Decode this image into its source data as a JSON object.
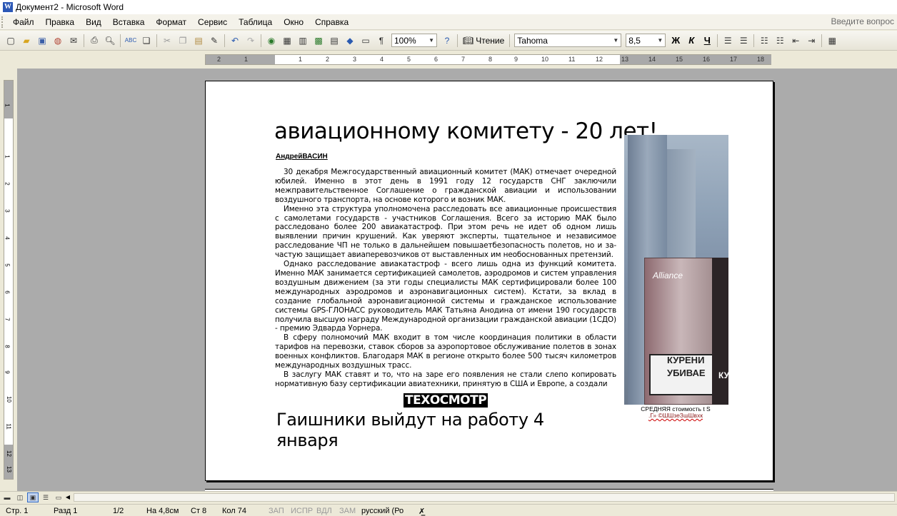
{
  "window": {
    "title": "Документ2 - Microsoft Word",
    "app_icon": "W"
  },
  "menu": {
    "items": [
      "Файл",
      "Правка",
      "Вид",
      "Вставка",
      "Формат",
      "Сервис",
      "Таблица",
      "Окно",
      "Справка"
    ],
    "help_placeholder": "Введите вопрос"
  },
  "toolbar": {
    "zoom": "100%",
    "read_label": "Чтение",
    "font_name": "Tahoma",
    "font_size": "8,5",
    "bold_label": "Ж",
    "italic_label": "К",
    "underline_label": "Ч",
    "icons": [
      "new-icon",
      "open-icon",
      "save-icon",
      "permission-icon",
      "email-icon",
      "print-icon",
      "print-preview-icon",
      "spelling-icon",
      "research-icon",
      "cut-icon",
      "copy-icon",
      "paste-icon",
      "format-painter-icon",
      "undo-icon",
      "redo-icon",
      "hyperlink-icon",
      "tables-borders-icon",
      "insert-table-icon",
      "insert-excel-icon",
      "columns-icon",
      "drawing-icon",
      "document-map-icon",
      "show-formatting-icon",
      "help-icon"
    ]
  },
  "ruler": {
    "h_labels": [
      "2",
      "1",
      "1",
      "2",
      "3",
      "4",
      "5",
      "6",
      "7",
      "8",
      "9",
      "10",
      "11",
      "12",
      "13",
      "14",
      "15",
      "16",
      "17",
      "18"
    ],
    "v_labels": [
      "1",
      "1",
      "2",
      "3",
      "4",
      "5",
      "6",
      "7",
      "8",
      "9",
      "10",
      "11",
      "12",
      "13"
    ]
  },
  "document": {
    "headline": "авиационному комитету - 20 лет!",
    "author": "АндрейВАСИН",
    "paragraphs": [
      "30 декабря Межгосударственный авиационный комитет (МАК) отмечает очередной юбилей. Именно в этот день в 1991 году 12 государств СНГ заключили межправительственное Соглашение о гражданской авиации и использовании воздушного транспорта, на основе которого и возник МАК.",
      "Именно эта структура уполномочена расследовать все авиационные происшествия с самолетами государств - участников Соглашения. Всего за историю МАК было расследовано более 200 авиакатастроф. При этом речь не идет об одном лишь выявлении причин крушений. Как уверяют эксперты, тщательное и независимое расследование ЧП не только в дальнейшем повышаетбезопасность полетов, но и за-частую защищает авиаперевозчиков от выставленных им необоснованных претензий.",
      "Однако расследование авиакатастроф - всего лишь одна из функций комитета. Именно МАК занимается сертификацией самолетов, аэродромов и систем управления воздушным движением (за эти годы специалисты МАК сертифицировали более 100 международных аэродромов и аэронавигационных систем). Кстати, за вклад в создание глобальной аэронавигационной системы и гражданское использование системы GPS-ГЛОНАСС руководитель МАК Татьяна Анодина от имени 190 государств получила высшую награду Международной организации гражданской авиации (1СДО) - премию Эдварда Уорнера.",
      "В сферу полномочий МАК входит в том числе координация политики в области тарифов на перевозки, ставок сборов за аэропортовое обслуживание полетов в зонах военных конфликтов. Благодаря МАК в регионе открыто более 500 тысяч километров международных воздушных трасс.",
      "В заслугу МАК ставят и то, что на заре его появления не стали слепо копировать нормативную базу сертификации авиатехники, принятую в США и Европе, а создали"
    ],
    "photo_text": {
      "brand": "Alliance",
      "warning_line1": "КУРЕНИ",
      "warning_line2": "УБИВАЕ",
      "warning_side": "КУ"
    },
    "caption_line1": "СРЕДНЯЯ стоимость t S",
    "caption_line2": ".Г» ©ШШзеЗшШвхк",
    "badge": "ТЕХОСМОТР",
    "subhead": "Гаишники выйдут на работу 4 января"
  },
  "status": {
    "page": "Стр.  1",
    "section": "Разд  1",
    "pages": "1/2",
    "at": "На  4,8см",
    "line": "Ст  8",
    "col": "Кол  74",
    "rec": "ЗАП",
    "trk": "ИСПР",
    "ext": "ВДЛ",
    "ovr": "ЗАМ",
    "language": "русский (Ро"
  }
}
